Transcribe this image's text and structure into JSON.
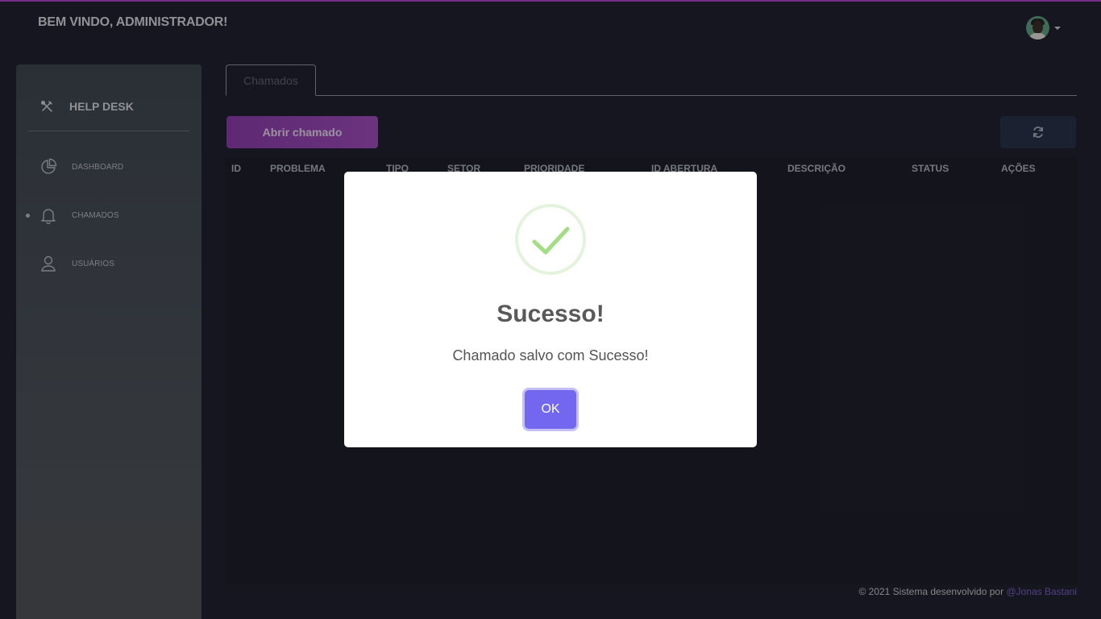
{
  "header": {
    "welcome": "BEM VINDO, ADMINISTRADOR!"
  },
  "sidebar": {
    "brand": "HELP DESK",
    "items": [
      {
        "label": "DASHBOARD",
        "icon": "pie-chart-icon",
        "active": false
      },
      {
        "label": "CHAMADOS",
        "icon": "bell-icon",
        "active": true
      },
      {
        "label": "USUÁRIOS",
        "icon": "user-icon",
        "active": false
      }
    ]
  },
  "tabs": [
    {
      "label": "Chamados",
      "active": true
    }
  ],
  "toolbar": {
    "open_ticket_label": "Abrir chamado",
    "refresh_icon": "refresh-icon"
  },
  "table": {
    "columns": [
      "ID",
      "PROBLEMA",
      "TIPO",
      "SETOR",
      "PRIORIDADE",
      "ID ABERTURA",
      "DESCRIÇÃO",
      "STATUS",
      "AÇÕES"
    ],
    "rows": []
  },
  "modal": {
    "title": "Sucesso!",
    "message": "Chamado salvo com Sucesso!",
    "ok_label": "OK",
    "icon": "success-check-icon"
  },
  "footer": {
    "text": "© 2021 Sistema desenvolvido por",
    "author": "@Jonas Bastani"
  },
  "colors": {
    "accent": "#b23cc6",
    "primary_button": "#9843b3",
    "modal_button": "#7367f0",
    "success": "#a5dc86",
    "link": "#7a5fc7"
  }
}
